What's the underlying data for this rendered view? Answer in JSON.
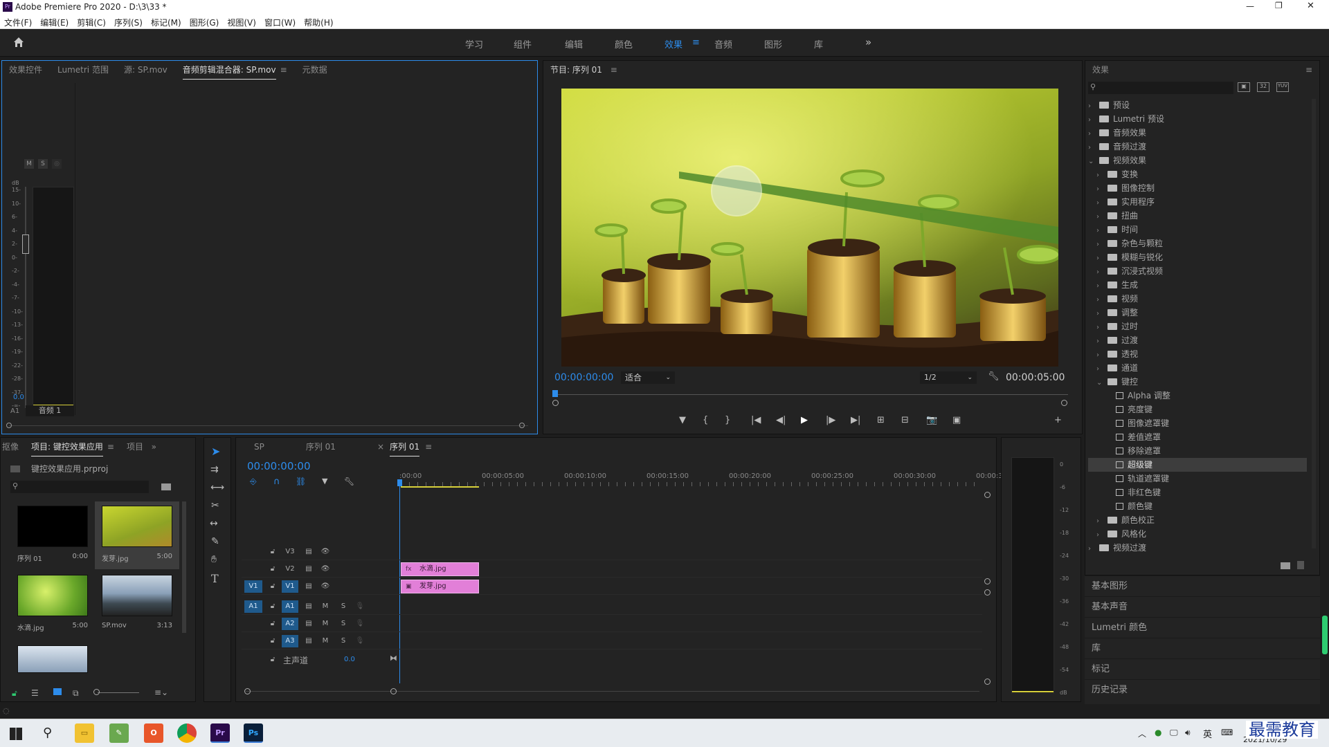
{
  "window": {
    "title": "Adobe Premiere Pro 2020 - D:\\3\\33 *",
    "app_badge": "Pr",
    "min": "—",
    "max": "❐",
    "close": "✕"
  },
  "menu": [
    "文件(F)",
    "编辑(E)",
    "剪辑(C)",
    "序列(S)",
    "标记(M)",
    "图形(G)",
    "视图(V)",
    "窗口(W)",
    "帮助(H)"
  ],
  "workspaces": {
    "tabs": [
      "学习",
      "组件",
      "编辑",
      "颜色",
      "效果",
      "音频",
      "图形",
      "库"
    ],
    "active": "效果",
    "more": "»",
    "menu_icon": "≡"
  },
  "source_panel": {
    "tabs": [
      "效果控件",
      "Lumetri 范围",
      "源: SP.mov",
      "音频剪辑混合器: SP.mov",
      "元数据"
    ],
    "active_tab": "音频剪辑混合器: SP.mov",
    "mixer": {
      "m": "M",
      "s": "S",
      "r": "◎",
      "db_label": "dB",
      "scale": [
        "15-",
        "10-",
        "6-",
        "4-",
        "2-",
        "0-",
        "-2-",
        "-4-",
        "-7-",
        "-10-",
        "-13-",
        "-16-",
        "-19-",
        "-22-",
        "-28-",
        "-37-",
        "-∞-"
      ],
      "value": "0.0",
      "track_id": "A1",
      "track_name": "音频 1"
    }
  },
  "program_monitor": {
    "title": "节目: 序列 01",
    "timecode_current": "00:00:00:00",
    "fit": "适合",
    "resolution": "1/2",
    "timecode_duration": "00:00:05:00",
    "buttons": [
      "▼",
      "{",
      "}",
      "|◀",
      "◀|",
      "▶",
      "|▶",
      "▶|",
      "⊞",
      "⊟",
      "📷",
      "▣",
      "+"
    ]
  },
  "effects_panel": {
    "title": "效果",
    "search_placeholder": "",
    "tree": [
      {
        "label": "预设",
        "level": 0,
        "open": false,
        "type": "folder-star"
      },
      {
        "label": "Lumetri 预设",
        "level": 0,
        "open": false,
        "type": "folder-star"
      },
      {
        "label": "音频效果",
        "level": 0,
        "open": false,
        "type": "folder"
      },
      {
        "label": "音频过渡",
        "level": 0,
        "open": false,
        "type": "folder"
      },
      {
        "label": "视频效果",
        "level": 0,
        "open": true,
        "type": "folder"
      },
      {
        "label": "变换",
        "level": 1,
        "open": false,
        "type": "folder"
      },
      {
        "label": "图像控制",
        "level": 1,
        "open": false,
        "type": "folder"
      },
      {
        "label": "实用程序",
        "level": 1,
        "open": false,
        "type": "folder"
      },
      {
        "label": "扭曲",
        "level": 1,
        "open": false,
        "type": "folder"
      },
      {
        "label": "时间",
        "level": 1,
        "open": false,
        "type": "folder"
      },
      {
        "label": "杂色与颗粒",
        "level": 1,
        "open": false,
        "type": "folder"
      },
      {
        "label": "模糊与锐化",
        "level": 1,
        "open": false,
        "type": "folder"
      },
      {
        "label": "沉浸式视频",
        "level": 1,
        "open": false,
        "type": "folder"
      },
      {
        "label": "生成",
        "level": 1,
        "open": false,
        "type": "folder"
      },
      {
        "label": "视频",
        "level": 1,
        "open": false,
        "type": "folder"
      },
      {
        "label": "调整",
        "level": 1,
        "open": false,
        "type": "folder"
      },
      {
        "label": "过时",
        "level": 1,
        "open": false,
        "type": "folder"
      },
      {
        "label": "过渡",
        "level": 1,
        "open": false,
        "type": "folder"
      },
      {
        "label": "透视",
        "level": 1,
        "open": false,
        "type": "folder"
      },
      {
        "label": "通道",
        "level": 1,
        "open": false,
        "type": "folder"
      },
      {
        "label": "键控",
        "level": 1,
        "open": true,
        "type": "folder"
      },
      {
        "label": "Alpha 调整",
        "level": 2,
        "type": "effect"
      },
      {
        "label": "亮度键",
        "level": 2,
        "type": "effect"
      },
      {
        "label": "图像遮罩键",
        "level": 2,
        "type": "effect"
      },
      {
        "label": "差值遮罩",
        "level": 2,
        "type": "effect"
      },
      {
        "label": "移除遮罩",
        "level": 2,
        "type": "effect"
      },
      {
        "label": "超级键",
        "level": 2,
        "type": "effect",
        "selected": true
      },
      {
        "label": "轨道遮罩键",
        "level": 2,
        "type": "effect"
      },
      {
        "label": "非红色键",
        "level": 2,
        "type": "effect"
      },
      {
        "label": "颜色键",
        "level": 2,
        "type": "effect"
      },
      {
        "label": "颜色校正",
        "level": 1,
        "open": false,
        "type": "folder"
      },
      {
        "label": "风格化",
        "level": 1,
        "open": false,
        "type": "folder"
      },
      {
        "label": "视频过渡",
        "level": 0,
        "open": false,
        "type": "folder"
      }
    ],
    "side_panels": [
      "基本图形",
      "基本声音",
      "Lumetri 颜色",
      "库",
      "标记",
      "历史记录"
    ]
  },
  "project_panel": {
    "tabs": [
      "抠像",
      "项目: 键控效果应用",
      "项目"
    ],
    "more": "»",
    "file": "键控效果应用.prproj",
    "items": [
      {
        "name": "序列 01",
        "duration": "0:00"
      },
      {
        "name": "发芽.jpg",
        "duration": "5:00"
      },
      {
        "name": "水滴.jpg",
        "duration": "5:00"
      },
      {
        "name": "SP.mov",
        "duration": "3:13"
      }
    ]
  },
  "timeline": {
    "tabs": [
      "SP",
      "序列 01",
      "序列 01"
    ],
    "active_tab": "序列 01",
    "timecode": "00:00:00:00",
    "ruler": [
      ":00:00",
      "00:00:05:00",
      "00:00:10:00",
      "00:00:15:00",
      "00:00:20:00",
      "00:00:25:00",
      "00:00:30:00",
      "00:00:35"
    ],
    "video_tracks": [
      "V3",
      "V2",
      "V1"
    ],
    "audio_tracks": [
      "A1",
      "A2",
      "A3"
    ],
    "source_v": "V1",
    "source_a": "A1",
    "master_label": "主声道",
    "master_value": "0.0",
    "mute": "M",
    "solo": "S",
    "clips": [
      {
        "name": "水滴.jpg",
        "track": "V2",
        "fx": "fx"
      },
      {
        "name": "发芽.jpg",
        "track": "V1",
        "fx": "▣"
      }
    ]
  },
  "audio_meter": {
    "scale": [
      "0",
      "-6",
      "-12",
      "-18",
      "-24",
      "-30",
      "-36",
      "-42",
      "-48",
      "-54",
      "dB"
    ]
  },
  "taskbar": {
    "tray": {
      "ime": "英",
      "date": "2021/10/29"
    },
    "watermark": "最需教育"
  },
  "colors": {
    "accent": "#2d8ceb",
    "clip": "#e27fd8",
    "panel": "#232323",
    "bg": "#1d1d1d"
  }
}
